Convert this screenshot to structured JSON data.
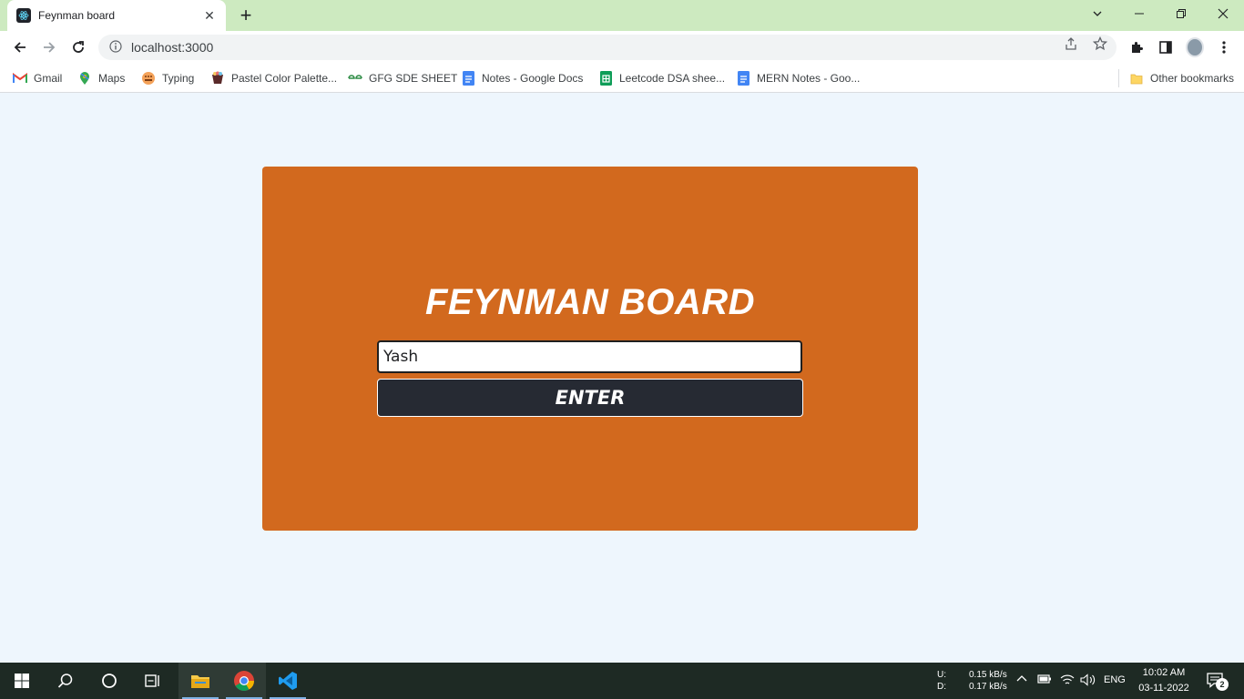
{
  "browser": {
    "tab_title": "Feynman board",
    "tab_close": "✕",
    "new_tab": "+",
    "url": "localhost:3000"
  },
  "bookmarks": [
    {
      "label": "Gmail",
      "icon": "gmail-icon"
    },
    {
      "label": "Maps",
      "icon": "maps-icon"
    },
    {
      "label": "Typing",
      "icon": "typing-icon"
    },
    {
      "label": "Pastel Color Palette...",
      "icon": "palette-icon"
    },
    {
      "label": "GFG SDE SHEET",
      "icon": "gfg-icon"
    },
    {
      "label": "Notes - Google Docs",
      "icon": "docs-icon"
    },
    {
      "label": "Leetcode DSA shee...",
      "icon": "sheets-icon"
    },
    {
      "label": "MERN Notes - Goo...",
      "icon": "docs-icon"
    }
  ],
  "other_bookmarks": "Other bookmarks",
  "page": {
    "heading": "FEYNMAN BOARD",
    "name_value": "Yash",
    "enter_label": "ENTER",
    "card_color": "#d2691e",
    "button_color": "#262a33",
    "background_color": "#eef6fd"
  },
  "taskbar": {
    "net_upload_label": "U:",
    "net_download_label": "D:",
    "net_upload": "0.15 kB/s",
    "net_download": "0.17 kB/s",
    "language": "ENG",
    "time": "10:02 AM",
    "date": "03-11-2022",
    "notifications_count": "2"
  }
}
